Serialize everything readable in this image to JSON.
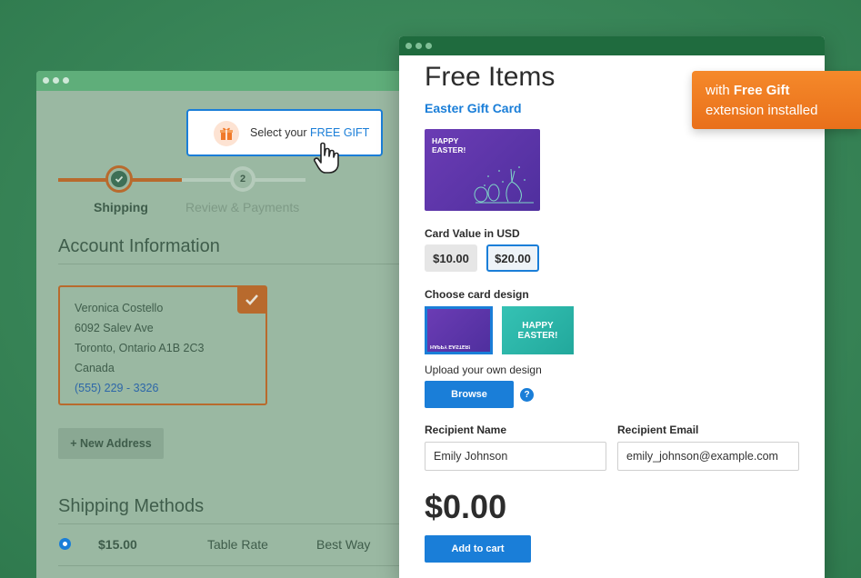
{
  "back_window": {
    "callout": {
      "prefix": "Select your",
      "highlight": "FREE GIFT"
    },
    "stepper": {
      "step1_label": "Shipping",
      "step2_number": "2",
      "step2_label": "Review & Payments"
    },
    "account_title": "Account Information",
    "address": {
      "name": "Veronica Costello",
      "street": "6092 Salev Ave",
      "city_line": "Toronto, Ontario A1B 2C3",
      "country": "Canada",
      "phone": "(555) 229 - 3326"
    },
    "new_address_label": "+ New Address",
    "shipping_title": "Shipping Methods",
    "shipping_method": {
      "price": "$15.00",
      "name": "Table Rate",
      "carrier": "Best Way"
    }
  },
  "front_window": {
    "title": "Free Items",
    "product_name": "Easter Gift Card",
    "card_image_text": "HAPPY\nEASTER!",
    "card_value_label": "Card Value in USD",
    "card_values": [
      "$10.00",
      "$20.00"
    ],
    "selected_value": "$20.00",
    "design_label": "Choose card design",
    "design1_text": "HAPPY EASTER!",
    "design2_text": "HAPPY\nEASTER!",
    "upload_label": "Upload your own design",
    "browse_label": "Browse",
    "help_symbol": "?",
    "recipient_name_label": "Recipient Name",
    "recipient_name_value": "Emily Johnson",
    "recipient_email_label": "Recipient Email",
    "recipient_email_value": "emily_johnson@example.com",
    "price": "$0.00",
    "add_to_cart_label": "Add to cart"
  },
  "badge": {
    "prefix": "with",
    "highlight": "Free Gift",
    "line2": "extension installed"
  },
  "colors": {
    "accent_blue": "#1a7ed8",
    "accent_orange": "#f5892a",
    "step_brown": "#b86a2d",
    "window_bar_green": "#1f6b3e"
  },
  "icons": [
    "gift-icon",
    "hand-cursor-icon",
    "check-icon",
    "help-icon"
  ]
}
